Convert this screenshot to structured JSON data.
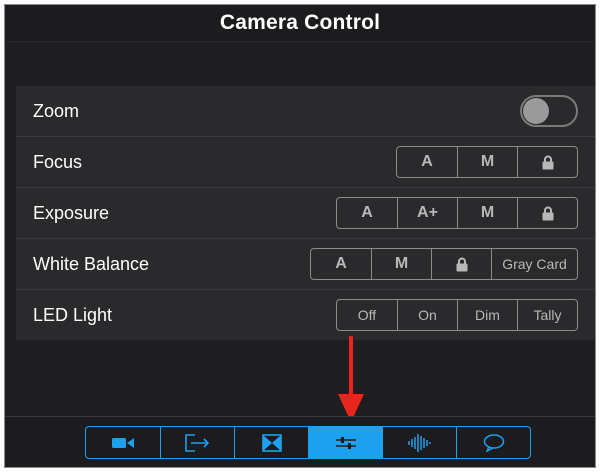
{
  "header": {
    "title": "Camera Control"
  },
  "settings": {
    "zoom": {
      "label": "Zoom",
      "toggle_on": false
    },
    "focus": {
      "label": "Focus",
      "options": [
        "A",
        "M",
        "lock-icon"
      ]
    },
    "exposure": {
      "label": "Exposure",
      "options": [
        "A",
        "A+",
        "M",
        "lock-icon"
      ]
    },
    "white_balance": {
      "label": "White Balance",
      "options": [
        "A",
        "M",
        "lock-icon",
        "Gray Card"
      ]
    },
    "led_light": {
      "label": "LED Light",
      "options": [
        "Off",
        "On",
        "Dim",
        "Tally"
      ]
    }
  },
  "tabbar": {
    "tabs": [
      "video-camera-icon",
      "share-export-icon",
      "crop-frame-icon",
      "sliders-icon",
      "audio-waveform-icon",
      "chat-bubble-icon"
    ],
    "active_index": 3
  },
  "colors": {
    "accent": "#1ba1ee",
    "annotation_arrow": "#e8261b"
  }
}
